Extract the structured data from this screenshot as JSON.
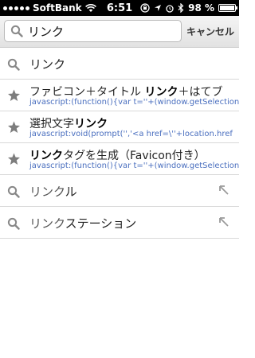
{
  "status": {
    "carrier": "SoftBank",
    "time": "6:51",
    "battery": "98 %"
  },
  "search": {
    "value": "リンク",
    "placeholder": "",
    "cancel_label": "キャンセル"
  },
  "suggestions": [
    {
      "type": "search",
      "text": "リンク"
    },
    {
      "type": "bookmark",
      "pre": "ファビコン＋タイトル ",
      "bold": "リンク",
      "post": "＋はてブ",
      "url": "javascript:(function(){var t=''+(window.getSelection"
    },
    {
      "type": "bookmark",
      "pre": "選択文字",
      "bold": "リンク",
      "post": "",
      "url": "javascript:void(prompt('','<a href=\\''+location.href"
    },
    {
      "type": "bookmark",
      "pre": "",
      "bold": "リンク",
      "post": "タグを生成（Favicon付き）",
      "url": "javascript:(function(){var t=''+(window.getSelection"
    },
    {
      "type": "query",
      "match": "リンク",
      "rest": "ル"
    },
    {
      "type": "query",
      "match": "リンク",
      "rest": "ステーション"
    }
  ],
  "icons": {
    "search": "search-icon",
    "star": "star-icon",
    "fill": "arrow-up-left-icon"
  }
}
